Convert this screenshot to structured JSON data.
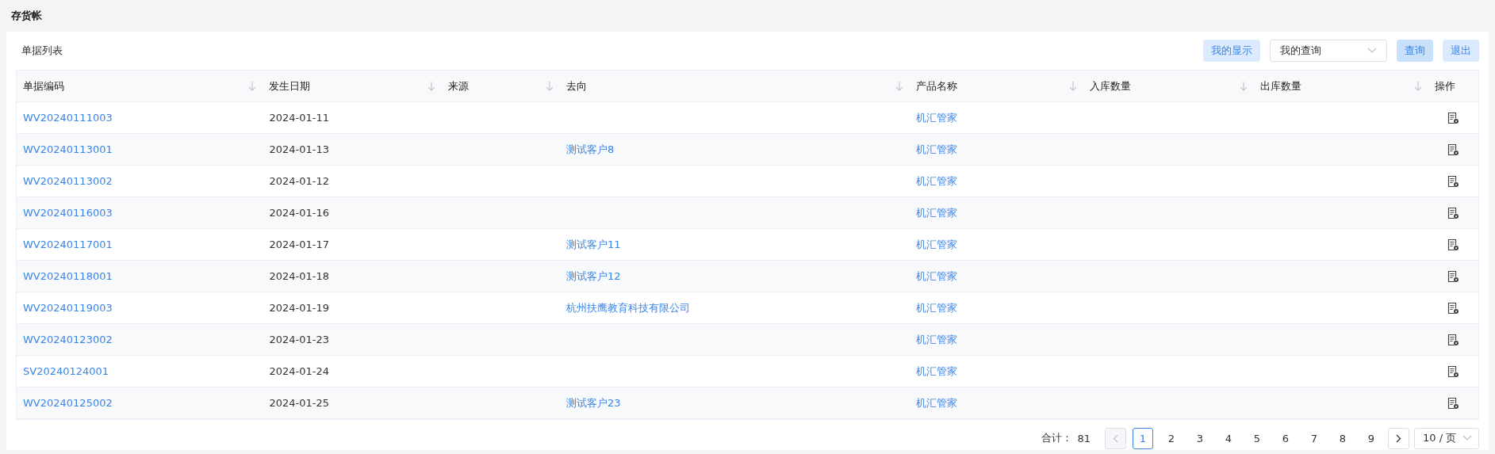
{
  "page_title": "存货帐",
  "toolbar": {
    "title": "单据列表",
    "display_button": "我的显示",
    "query_select": {
      "value": "我的查询"
    },
    "query_button": "查询",
    "exit_button": "退出"
  },
  "table": {
    "columns": [
      {
        "label": "单据编码",
        "sortable": true
      },
      {
        "label": "发生日期",
        "sortable": true
      },
      {
        "label": "来源",
        "sortable": true
      },
      {
        "label": "去向",
        "sortable": true
      },
      {
        "label": "产品名称",
        "sortable": true
      },
      {
        "label": "入库数量",
        "sortable": true
      },
      {
        "label": "出库数量",
        "sortable": true
      },
      {
        "label": "操作",
        "sortable": false
      }
    ],
    "rows": [
      {
        "code": "WV20240111003",
        "date": "2024-01-11",
        "destination": "",
        "product": "机汇管家"
      },
      {
        "code": "WV20240113001",
        "date": "2024-01-13",
        "destination": "测试客户8",
        "product": "机汇管家"
      },
      {
        "code": "WV20240113002",
        "date": "2024-01-12",
        "destination": "",
        "product": "机汇管家"
      },
      {
        "code": "WV20240116003",
        "date": "2024-01-16",
        "destination": "",
        "product": "机汇管家"
      },
      {
        "code": "WV20240117001",
        "date": "2024-01-17",
        "destination": "测试客户11",
        "product": "机汇管家"
      },
      {
        "code": "WV20240118001",
        "date": "2024-01-18",
        "destination": "测试客户12",
        "product": "机汇管家"
      },
      {
        "code": "WV20240119003",
        "date": "2024-01-19",
        "destination": "杭州扶鹰教育科技有限公司",
        "product": "机汇管家"
      },
      {
        "code": "WV20240123002",
        "date": "2024-01-23",
        "destination": "",
        "product": "机汇管家"
      },
      {
        "code": "SV20240124001",
        "date": "2024-01-24",
        "destination": "",
        "product": "机汇管家"
      },
      {
        "code": "WV20240125002",
        "date": "2024-01-25",
        "destination": "测试客户23",
        "product": "机汇管家"
      }
    ]
  },
  "pagination": {
    "total_label": "合计：",
    "total": "81",
    "prev_disabled": true,
    "next_disabled": false,
    "pages": [
      {
        "label": "1",
        "selected": true
      },
      {
        "label": "2",
        "selected": false
      },
      {
        "label": "3",
        "selected": false
      },
      {
        "label": "4",
        "selected": false
      },
      {
        "label": "5",
        "selected": false
      },
      {
        "label": "6",
        "selected": false
      },
      {
        "label": "7",
        "selected": false
      },
      {
        "label": "8",
        "selected": false
      },
      {
        "label": "9",
        "selected": false
      }
    ],
    "page_size": "10 / 页"
  }
}
